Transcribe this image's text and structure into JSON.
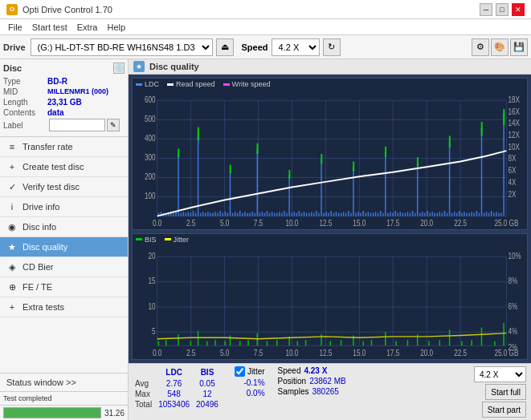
{
  "titlebar": {
    "title": "Opti Drive Control 1.70",
    "icon_label": "O",
    "minimize_label": "─",
    "maximize_label": "□",
    "close_label": "✕"
  },
  "menubar": {
    "items": [
      "File",
      "Start test",
      "Extra",
      "Help"
    ]
  },
  "toolbar": {
    "drive_label": "Drive",
    "drive_value": "(G:)  HL-DT-ST BD-RE  WH16NS48 1.D3",
    "speed_label": "Speed",
    "speed_value": "4.2 X"
  },
  "disc": {
    "section_label": "Disc",
    "type_label": "Type",
    "type_value": "BD-R",
    "mid_label": "MID",
    "mid_value": "MILLENMR1 (000)",
    "length_label": "Length",
    "length_value": "23,31 GB",
    "contents_label": "Contents",
    "contents_value": "data",
    "label_label": "Label",
    "label_placeholder": ""
  },
  "nav": {
    "items": [
      {
        "id": "transfer-rate",
        "label": "Transfer rate",
        "icon": "≡"
      },
      {
        "id": "create-test-disc",
        "label": "Create test disc",
        "icon": "+"
      },
      {
        "id": "verify-test-disc",
        "label": "Verify test disc",
        "icon": "✓"
      },
      {
        "id": "drive-info",
        "label": "Drive info",
        "icon": "i"
      },
      {
        "id": "disc-info",
        "label": "Disc info",
        "icon": "💿"
      },
      {
        "id": "disc-quality",
        "label": "Disc quality",
        "icon": "★",
        "active": true
      },
      {
        "id": "cd-bier",
        "label": "CD Bier",
        "icon": "🍺"
      },
      {
        "id": "fe-te",
        "label": "FE / TE",
        "icon": "⊕"
      },
      {
        "id": "extra-tests",
        "label": "Extra tests",
        "icon": "+"
      }
    ]
  },
  "status_window": {
    "label": "Status window >> "
  },
  "progress": {
    "value": 100,
    "text": "31.26",
    "status": "Test completed"
  },
  "disc_quality": {
    "title": "Disc quality",
    "chart1": {
      "legend": [
        {
          "label": "LDC",
          "color": "#4488ff"
        },
        {
          "label": "Read speed",
          "color": "#ffffff"
        },
        {
          "label": "Write speed",
          "color": "#ff44ff"
        }
      ],
      "y_max": 600,
      "y_labels": [
        "600",
        "500",
        "400",
        "300",
        "200",
        "100"
      ],
      "y_right_labels": [
        "18X",
        "16X",
        "14X",
        "12X",
        "10X",
        "8X",
        "6X",
        "4X",
        "2X"
      ],
      "x_labels": [
        "0.0",
        "2.5",
        "5.0",
        "7.5",
        "10.0",
        "12.5",
        "15.0",
        "17.5",
        "20.0",
        "22.5",
        "25.0 GB"
      ]
    },
    "chart2": {
      "legend": [
        {
          "label": "BIS",
          "color": "#00ff00"
        },
        {
          "label": "Jitter",
          "color": "#ffff00"
        }
      ],
      "y_max": 20,
      "y_labels": [
        "20",
        "15",
        "10",
        "5"
      ],
      "y_right_labels": [
        "10%",
        "8%",
        "6%",
        "4%",
        "2%"
      ],
      "x_labels": [
        "0.0",
        "2.5",
        "5.0",
        "7.5",
        "10.0",
        "12.5",
        "15.0",
        "17.5",
        "20.0",
        "22.5",
        "25.0 GB"
      ]
    }
  },
  "stats": {
    "col_ldc": "LDC",
    "col_bis": "BIS",
    "col_jitter": "Jitter",
    "row_avg": {
      "label": "Avg",
      "ldc": "2.76",
      "bis": "0.05",
      "jitter": "-0.1%"
    },
    "row_max": {
      "label": "Max",
      "ldc": "548",
      "bis": "12",
      "jitter": "0.0%"
    },
    "row_total": {
      "label": "Total",
      "ldc": "1053406",
      "bis": "20496",
      "jitter": ""
    },
    "jitter_checked": true,
    "speed_label": "Speed",
    "speed_value": "4.23 X",
    "speed_select": "4.2 X",
    "position_label": "Position",
    "position_value": "23862 MB",
    "samples_label": "Samples",
    "samples_value": "380265",
    "start_full_label": "Start full",
    "start_part_label": "Start part"
  }
}
